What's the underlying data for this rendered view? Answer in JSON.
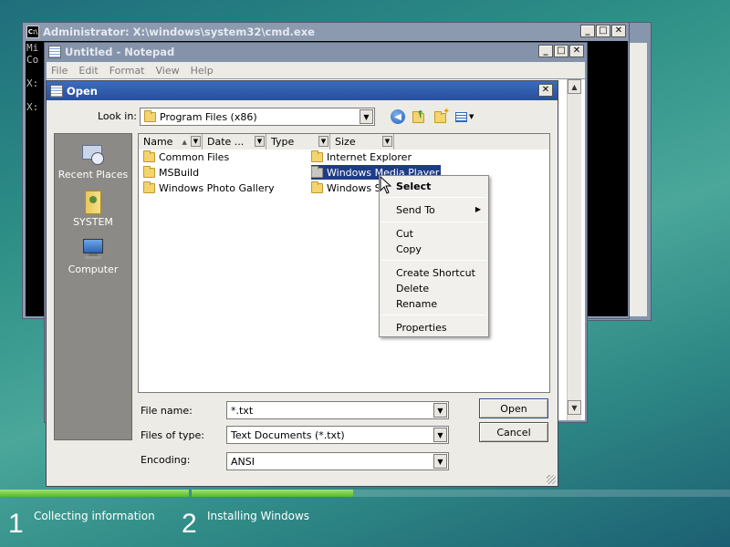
{
  "cmd": {
    "title": "Administrator: X:\\windows\\system32\\cmd.exe",
    "lines": [
      "Mi",
      "Co",
      "",
      "X:",
      "",
      "X:"
    ]
  },
  "notepad": {
    "title": "Untitled - Notepad",
    "menu": [
      "File",
      "Edit",
      "Format",
      "View",
      "Help"
    ]
  },
  "open_dialog": {
    "title": "Open",
    "look_in_label": "Look in:",
    "look_in_value": "Program Files (x86)",
    "columns": [
      "Name",
      "Date ...",
      "Type",
      "Size"
    ],
    "places": [
      {
        "label": "Recent Places",
        "icon": "recent-places-icon"
      },
      {
        "label": "SYSTEM",
        "icon": "user-folder-icon"
      },
      {
        "label": "Computer",
        "icon": "computer-icon"
      }
    ],
    "items_col1": [
      "Common Files",
      "MSBuild",
      "Windows Photo Gallery"
    ],
    "items_col2": [
      "Internet Explorer",
      "Windows Media Player",
      "Windows Sid"
    ],
    "selected_item": "Windows Media Player",
    "file_name_label": "File name:",
    "file_name_value": "*.txt",
    "files_of_type_label": "Files of type:",
    "files_of_type_value": "Text Documents (*.txt)",
    "encoding_label": "Encoding:",
    "encoding_value": "ANSI",
    "open_button": "Open",
    "cancel_button": "Cancel"
  },
  "context_menu": {
    "select": "Select",
    "send_to": "Send To",
    "cut": "Cut",
    "copy": "Copy",
    "create_shortcut": "Create Shortcut",
    "delete": "Delete",
    "rename": "Rename",
    "properties": "Properties"
  },
  "setup": {
    "steps": [
      {
        "number": "1",
        "label": "Collecting information",
        "progress": 1.0
      },
      {
        "number": "2",
        "label": "Installing Windows",
        "progress": 0.3
      }
    ]
  },
  "colors": {
    "title_active": "#2c5ca8",
    "title_inactive": "#7f8da3",
    "selection": "#1d3c88",
    "progress_fill": "#6cc93e"
  }
}
